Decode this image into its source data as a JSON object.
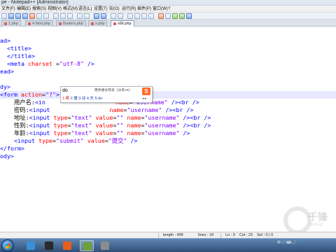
{
  "window": {
    "title": "pe - Notepad++ [Administrator]"
  },
  "menu": [
    "文件(F)",
    "编辑(E)",
    "搜索(S)",
    "视图(V)",
    "格式(M)",
    "语言(L)",
    "设置(T)",
    "宏(O)",
    "运行(R)",
    "插件(P)",
    "窗口(W)",
    "?"
  ],
  "tabs": [
    {
      "label": "1.php",
      "active": false
    },
    {
      "label": "4.html.php",
      "active": false
    },
    {
      "label": "floaters.php",
      "active": false
    },
    {
      "label": "x.php",
      "active": false
    },
    {
      "label": "x66.php",
      "active": true
    }
  ],
  "code_lines": [
    [],
    [
      {
        "c": "tag",
        "t": "ad>"
      }
    ],
    [
      {
        "c": "tag",
        "t": "  <title>"
      }
    ],
    [
      {
        "c": "tag",
        "t": "  </title>"
      }
    ],
    [
      {
        "c": "tag",
        "t": "  <meta "
      },
      {
        "c": "attr",
        "t": "charset "
      },
      {
        "c": "txt",
        "t": "="
      },
      {
        "c": "str",
        "t": "\"utf-8\""
      },
      {
        "c": "tag",
        "t": " />"
      }
    ],
    [
      {
        "c": "tag",
        "t": "ead>"
      }
    ],
    [],
    [
      {
        "c": "tag",
        "t": "dy>"
      }
    ],
    [
      {
        "c": "tag",
        "t": "<form "
      },
      {
        "c": "attr",
        "t": "action"
      },
      {
        "c": "txt",
        "t": "="
      },
      {
        "c": "str",
        "t": "\"?\""
      },
      {
        "c": "tag",
        "t": ">"
      }
    ],
    [
      {
        "c": "txt",
        "t": "    用户名:"
      },
      {
        "c": "tag",
        "t": "<in"
      },
      {
        "c": "tag",
        "t": "                  "
      },
      {
        "c": "str",
        "t": "\""
      },
      {
        "c": "attr",
        "t": " name"
      },
      {
        "c": "txt",
        "t": "="
      },
      {
        "c": "str",
        "t": "\"username\""
      },
      {
        "c": "tag",
        "t": " /><br />"
      }
    ],
    [
      {
        "c": "txt",
        "t": "    密码:"
      },
      {
        "c": "tag",
        "t": "<input"
      },
      {
        "c": "tag",
        "t": "                 "
      },
      {
        "c": "attr",
        "t": "name"
      },
      {
        "c": "txt",
        "t": "="
      },
      {
        "c": "str",
        "t": "\"username\""
      },
      {
        "c": "tag",
        "t": " /><br />"
      }
    ],
    [
      {
        "c": "txt",
        "t": "    地址:"
      },
      {
        "c": "tag",
        "t": "<input "
      },
      {
        "c": "attr",
        "t": "type"
      },
      {
        "c": "txt",
        "t": "="
      },
      {
        "c": "str",
        "t": "\"text\""
      },
      {
        "c": "attr",
        "t": " value"
      },
      {
        "c": "txt",
        "t": "="
      },
      {
        "c": "str",
        "t": "\"\""
      },
      {
        "c": "attr",
        "t": " name"
      },
      {
        "c": "txt",
        "t": "="
      },
      {
        "c": "str",
        "t": "\"username\""
      },
      {
        "c": "tag",
        "t": " /><br />"
      }
    ],
    [
      {
        "c": "txt",
        "t": "    性别:"
      },
      {
        "c": "tag",
        "t": "<input "
      },
      {
        "c": "attr",
        "t": "type"
      },
      {
        "c": "txt",
        "t": "="
      },
      {
        "c": "str",
        "t": "\"text\""
      },
      {
        "c": "attr",
        "t": " value"
      },
      {
        "c": "txt",
        "t": "="
      },
      {
        "c": "str",
        "t": "\"\""
      },
      {
        "c": "attr",
        "t": " name"
      },
      {
        "c": "txt",
        "t": "="
      },
      {
        "c": "str",
        "t": "\"username\""
      },
      {
        "c": "tag",
        "t": " /><br />"
      }
    ],
    [
      {
        "c": "txt",
        "t": "    年龄:"
      },
      {
        "c": "tag",
        "t": "<input "
      },
      {
        "c": "attr",
        "t": "type"
      },
      {
        "c": "txt",
        "t": "="
      },
      {
        "c": "str",
        "t": "\"text\""
      },
      {
        "c": "attr",
        "t": " value"
      },
      {
        "c": "txt",
        "t": "="
      },
      {
        "c": "str",
        "t": "\"\""
      },
      {
        "c": "attr",
        "t": " name"
      },
      {
        "c": "txt",
        "t": "="
      },
      {
        "c": "str",
        "t": "\"username\""
      },
      {
        "c": "tag",
        "t": " />"
      }
    ],
    [
      {
        "c": "tag",
        "t": "    <input "
      },
      {
        "c": "attr",
        "t": "type"
      },
      {
        "c": "txt",
        "t": "="
      },
      {
        "c": "str",
        "t": "\"submit\""
      },
      {
        "c": "attr",
        "t": " value"
      },
      {
        "c": "txt",
        "t": "="
      },
      {
        "c": "str",
        "t": "\"提交\""
      },
      {
        "c": "tag",
        "t": " />"
      }
    ],
    [
      {
        "c": "tag",
        "t": "</form>"
      }
    ],
    [
      {
        "c": "tag",
        "t": "ody>"
      }
    ]
  ],
  "ime": {
    "pinyin": "do",
    "tip": "更多搜文符去（分号+E）",
    "candidates": [
      "1.都",
      "2.懂",
      "3.动",
      "4.东",
      "5.do"
    ],
    "pager": "◂ ▸",
    "logo": "S"
  },
  "status": {
    "length": "length : 499",
    "lines": "lines : 18",
    "ln": "Ln : 9",
    "col": "Col : 23",
    "sel": "Sel : 0 | 0"
  },
  "watermark": {
    "text": "千锋",
    "sub": "www.qf"
  },
  "taskbar": {
    "tray": "中 ◇ ⌨ 🔊",
    "time": "",
    "colors": [
      "#3b8fd8",
      "#2a2a2a",
      "#e85e1a",
      "#6aa13a",
      "#8c8c8c"
    ]
  }
}
